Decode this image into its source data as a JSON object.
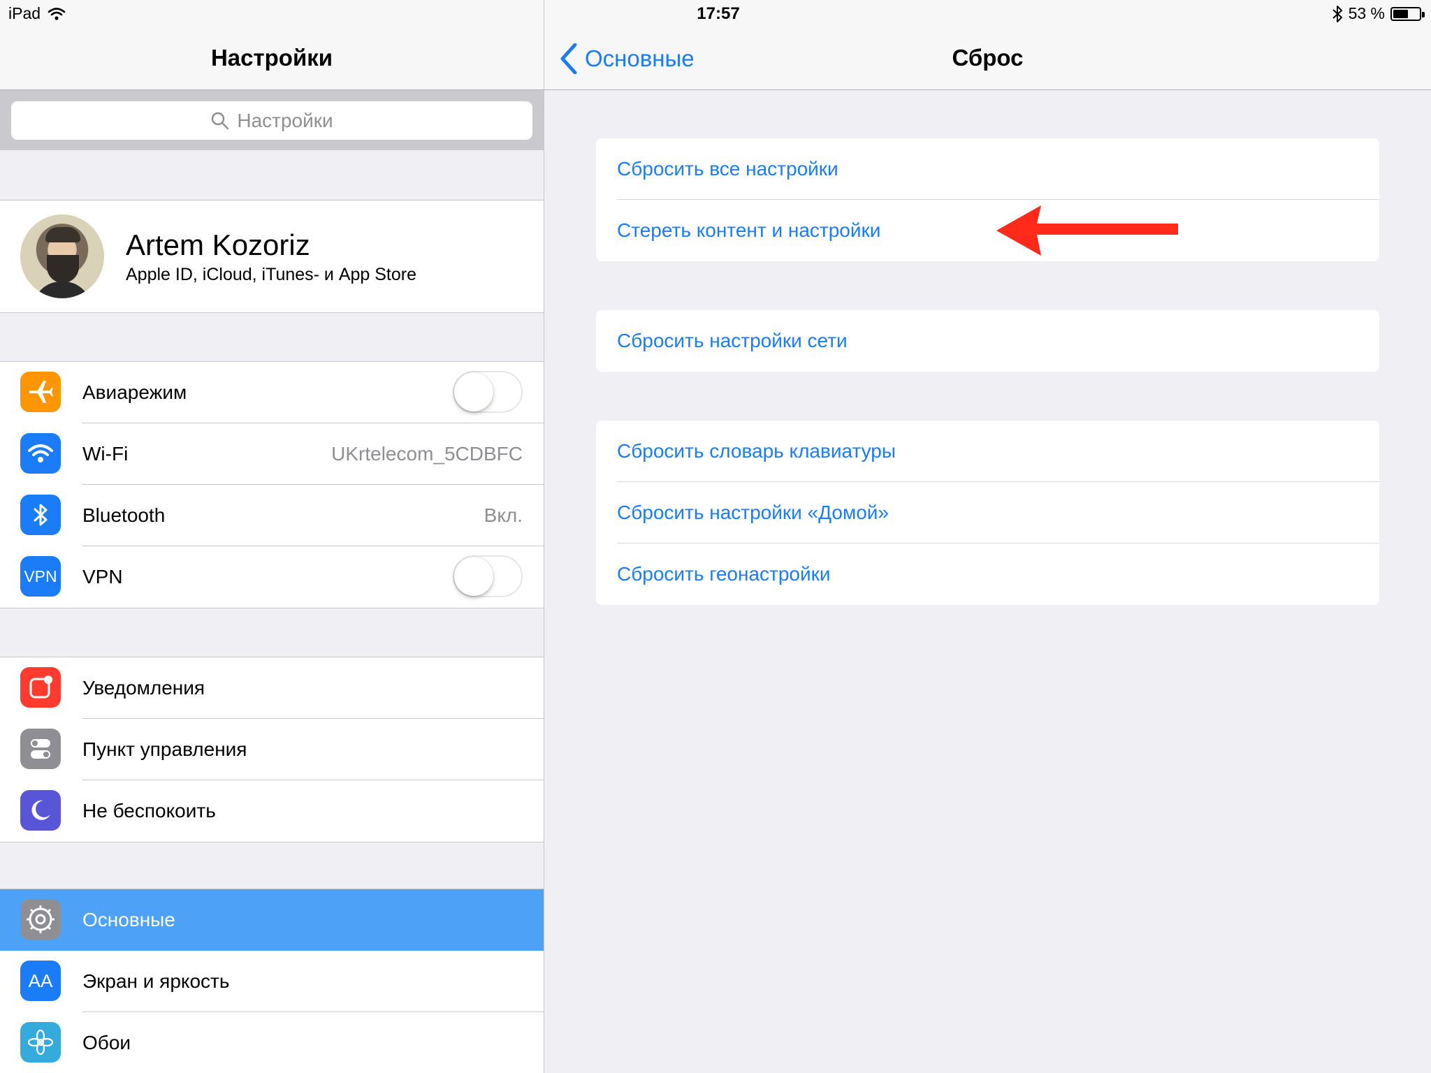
{
  "status_bar": {
    "device": "iPad",
    "time": "17:57",
    "battery_percent": "53 %"
  },
  "left_pane": {
    "title": "Настройки",
    "search_placeholder": "Настройки",
    "profile": {
      "name": "Artem Kozoriz",
      "subtitle": "Apple ID, iCloud, iTunes- и App Store"
    },
    "group_connectivity": [
      {
        "label": "Авиарежим",
        "icon": "airplane-icon",
        "color": "#ff9500",
        "toggle": false
      },
      {
        "label": "Wi-Fi",
        "icon": "wifi-icon",
        "color": "#1a7cf6",
        "value": "UKrtelecom_5CDBFC"
      },
      {
        "label": "Bluetooth",
        "icon": "bluetooth-icon",
        "color": "#1a7cf6",
        "value": "Вкл."
      },
      {
        "label": "VPN",
        "icon": "vpn-icon",
        "icon_text": "VPN",
        "color": "#1a7cf6",
        "toggle": false
      }
    ],
    "group_notifications": [
      {
        "label": "Уведомления",
        "icon": "notifications-icon",
        "color": "#ff3b30"
      },
      {
        "label": "Пункт управления",
        "icon": "control-center-icon",
        "color": "#8e8e93"
      },
      {
        "label": "Не беспокоить",
        "icon": "moon-icon",
        "color": "#5856d6"
      }
    ],
    "group_general": [
      {
        "label": "Основные",
        "icon": "gear-icon",
        "color": "#8e8e93",
        "selected": true
      },
      {
        "label": "Экран и яркость",
        "icon": "display-brightness-icon",
        "icon_text": "AA",
        "color": "#1a7cf6"
      },
      {
        "label": "Обои",
        "icon": "wallpaper-icon",
        "color": "#35aadc"
      }
    ]
  },
  "right_pane": {
    "back_label": "Основные",
    "title": "Сброс",
    "groups": [
      [
        "Сбросить все настройки",
        "Стереть контент и настройки"
      ],
      [
        "Сбросить настройки сети"
      ],
      [
        "Сбросить словарь клавиатуры",
        "Сбросить настройки «Домой»",
        "Сбросить геонастройки"
      ]
    ]
  },
  "colors": {
    "accent": "#1a7cf6",
    "selected_row": "#4da2f7",
    "annotation_arrow": "#ff2a1a"
  }
}
